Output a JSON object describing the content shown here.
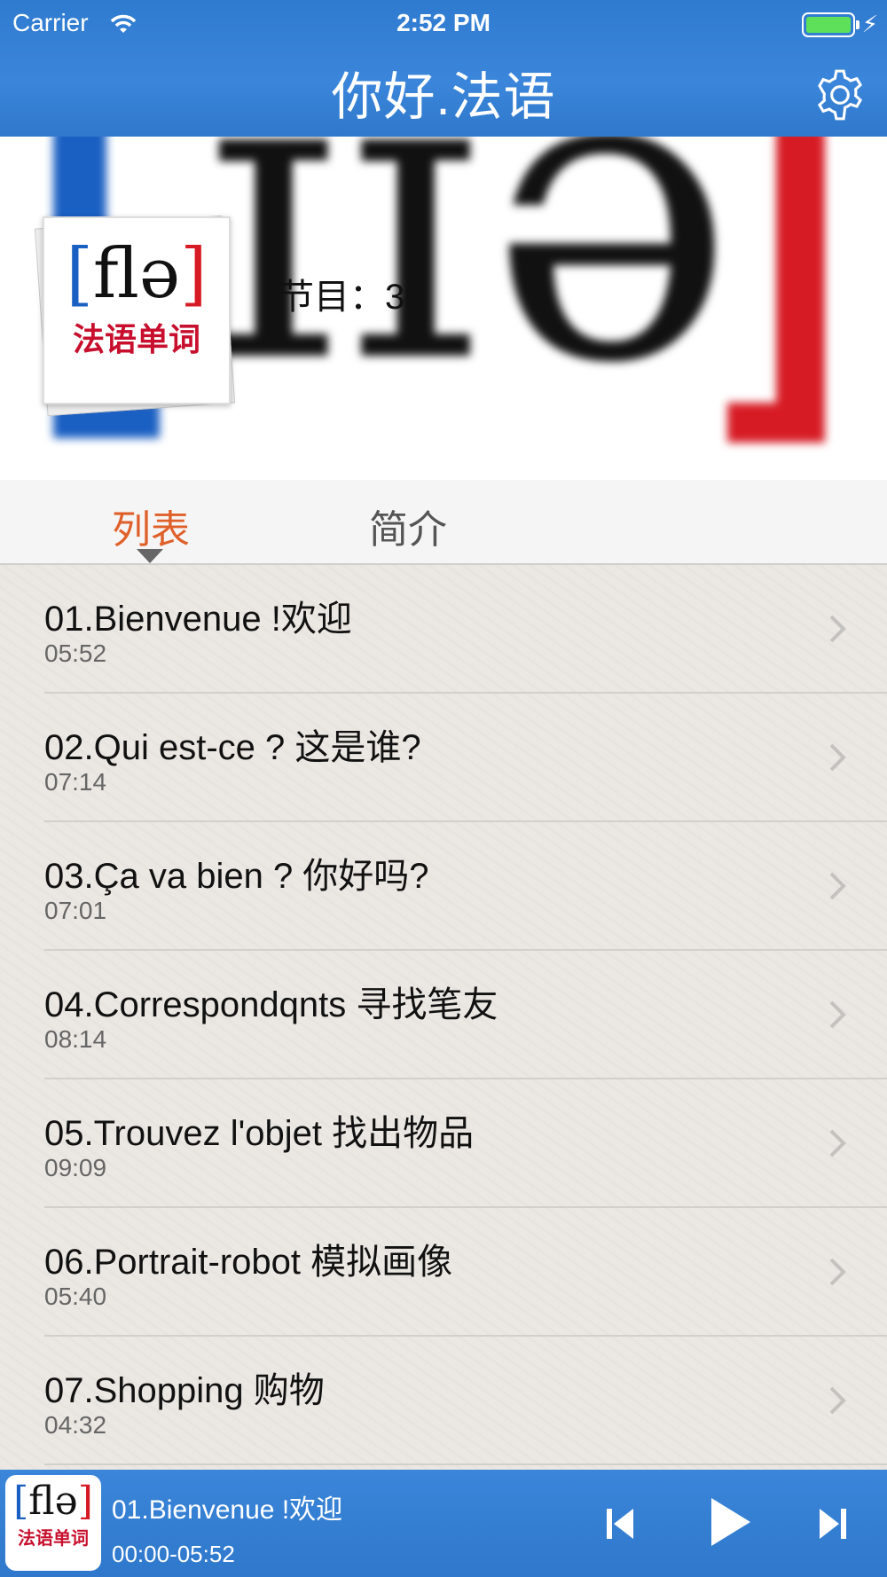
{
  "status_bar": {
    "carrier": "Carrier",
    "time": "2:52 PM"
  },
  "header": {
    "title": "你好.法语",
    "settings_icon": "gear-icon"
  },
  "banner": {
    "cover_ipa": "flə",
    "cover_subtitle": "法语单词",
    "episodes_label": "节目：36"
  },
  "tabs": [
    {
      "label": "列表",
      "active": true
    },
    {
      "label": "简介",
      "active": false
    }
  ],
  "lessons": [
    {
      "title": "01.Bienvenue !欢迎",
      "duration": "05:52"
    },
    {
      "title": "02.Qui est-ce ? 这是谁?",
      "duration": "07:14"
    },
    {
      "title": "03.Ça va bien ? 你好吗?",
      "duration": "07:01"
    },
    {
      "title": "04.Correspondqnts 寻找笔友",
      "duration": "08:14"
    },
    {
      "title": "05.Trouvez l'objet 找出物品",
      "duration": "09:09"
    },
    {
      "title": "06.Portrait-robot 模拟画像",
      "duration": "05:40"
    },
    {
      "title": "07.Shopping 购物",
      "duration": "04:32"
    }
  ],
  "player": {
    "now_playing": "01.Bienvenue !欢迎",
    "time": "00:00-05:52",
    "cover_ipa": "flə",
    "cover_subtitle": "法语单词"
  },
  "colors": {
    "accent_tab": "#e0602a",
    "bar_blue": "#3b86da"
  }
}
